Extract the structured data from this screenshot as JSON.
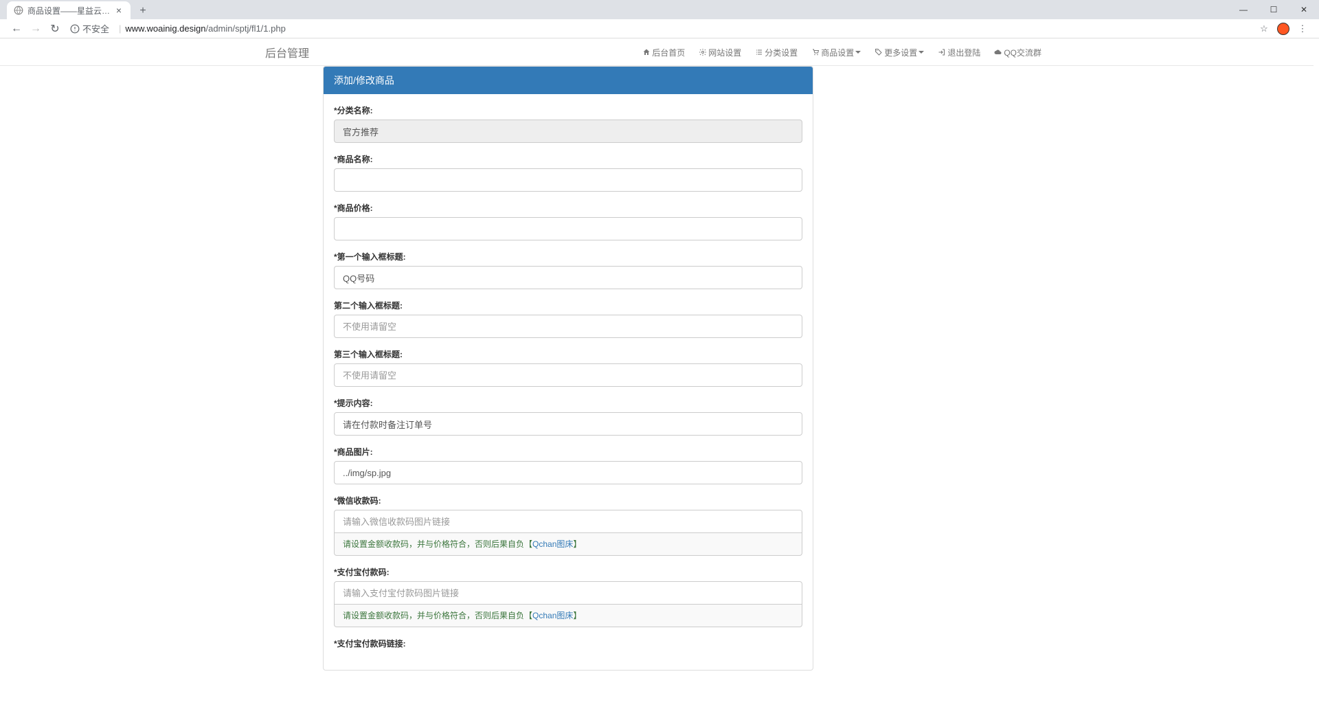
{
  "browser": {
    "tab_title": "商品设置——星益云商城系统",
    "url_insecure_label": "不安全",
    "url_domain": "www.woainig.design",
    "url_path": "/admin/sptj/fl1/1.php"
  },
  "navbar": {
    "brand": "后台管理",
    "items": [
      {
        "label": "后台首页",
        "icon": "home"
      },
      {
        "label": "网站设置",
        "icon": "gear"
      },
      {
        "label": "分类设置",
        "icon": "list"
      },
      {
        "label": "商品设置",
        "icon": "cart",
        "dropdown": true
      },
      {
        "label": "更多设置",
        "icon": "tags",
        "dropdown": true
      },
      {
        "label": "退出登陆",
        "icon": "logout"
      },
      {
        "label": "QQ交流群",
        "icon": "cloud"
      }
    ]
  },
  "panel": {
    "title": "添加/修改商品"
  },
  "form": {
    "category_label": "*分类名称:",
    "category_value": "官方推荐",
    "name_label": "*商品名称:",
    "name_value": "",
    "price_label": "*商品价格:",
    "price_value": "",
    "input1_label": "*第一个输入框标题:",
    "input1_value": "QQ号码",
    "input2_label": "第二个输入框标题:",
    "input2_placeholder": "不使用请留空",
    "input3_label": "第三个输入框标题:",
    "input3_placeholder": "不使用请留空",
    "tip_label": "*提示内容:",
    "tip_value": "请在付款时备注订单号",
    "image_label": "*商品图片:",
    "image_value": "../img/sp.jpg",
    "wechat_label": "*微信收款码:",
    "wechat_placeholder": "请输入微信收款码图片链接",
    "wechat_help_prefix": "请设置金额收款码，并与价格符合，否则后果自负【",
    "wechat_help_link": "Qchan图床",
    "wechat_help_suffix": "】",
    "alipay_label": "*支付宝付款码:",
    "alipay_placeholder": "请输入支付宝付款码图片链接",
    "alipay_help_prefix": "请设置金额收款码，并与价格符合，否则后果自负【",
    "alipay_help_link": "Qchan图床",
    "alipay_help_suffix": "】",
    "alipay_link_label": "*支付宝付款码链接:"
  }
}
